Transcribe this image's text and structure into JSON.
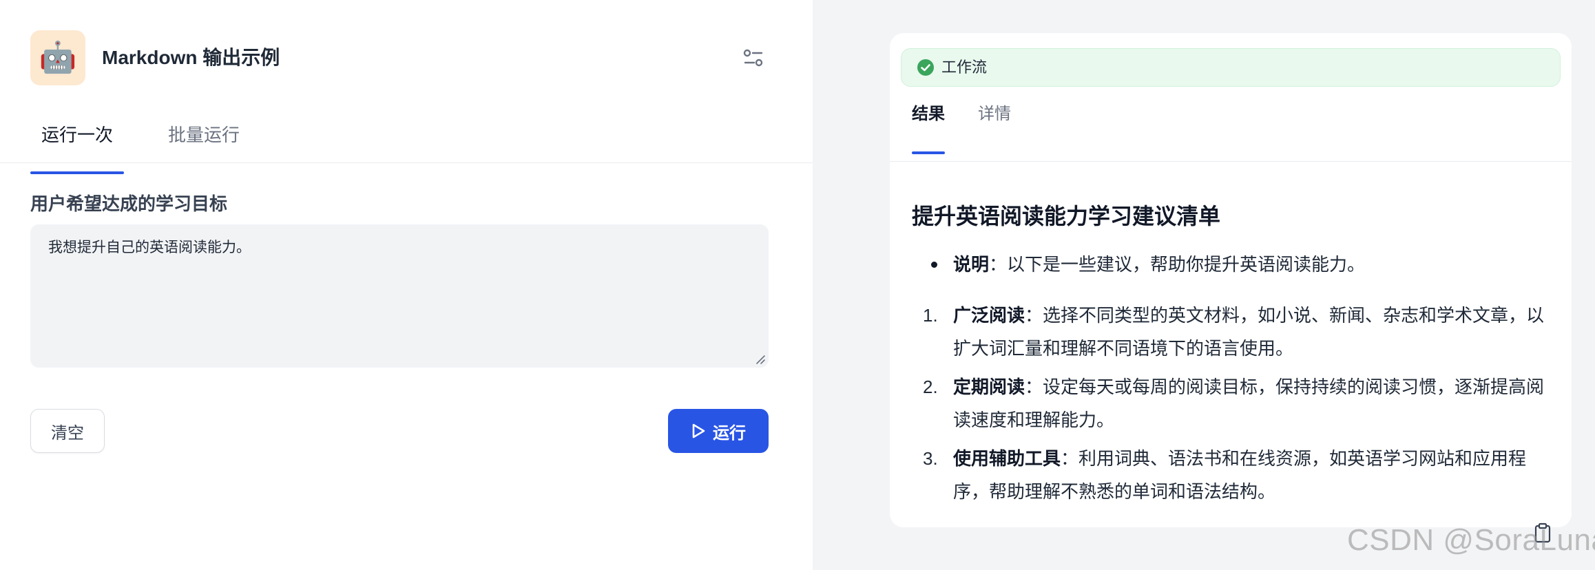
{
  "app": {
    "title": "Markdown 输出示例",
    "icon": "robot-emoji-icon",
    "icon_glyph": "🤖"
  },
  "left_tabs": [
    {
      "label": "运行一次",
      "active": true
    },
    {
      "label": "批量运行",
      "active": false
    }
  ],
  "input": {
    "label": "用户希望达成的学习目标",
    "value": "我想提升自己的英语阅读能力。"
  },
  "buttons": {
    "clear": "清空",
    "run": "运行"
  },
  "result": {
    "workflow_label": "工作流",
    "tabs": [
      {
        "label": "结果",
        "active": true
      },
      {
        "label": "详情",
        "active": false
      }
    ],
    "heading": "提升英语阅读能力学习建议清单",
    "bullet": {
      "strong": "说明",
      "text": "：以下是一些建议，帮助你提升英语阅读能力。"
    },
    "items": [
      {
        "num": "1.",
        "strong": "广泛阅读",
        "text": "：选择不同类型的英文材料，如小说、新闻、杂志和学术文章，以扩大词汇量和理解不同语境下的语言使用。"
      },
      {
        "num": "2.",
        "strong": "定期阅读",
        "text": "：设定每天或每周的阅读目标，保持持续的阅读习惯，逐渐提高阅读速度和理解能力。"
      },
      {
        "num": "3.",
        "strong": "使用辅助工具",
        "text": "：利用词典、语法书和在线资源，如英语学习网站和应用程序，帮助理解不熟悉的单词和语法结构。"
      }
    ]
  },
  "watermark": "CSDN @SoraLuna",
  "colors": {
    "accent": "#2955e5",
    "success": "#3aa55c",
    "workflow_bg": "#e9f9ee",
    "icon_bg": "#fde8d0"
  }
}
